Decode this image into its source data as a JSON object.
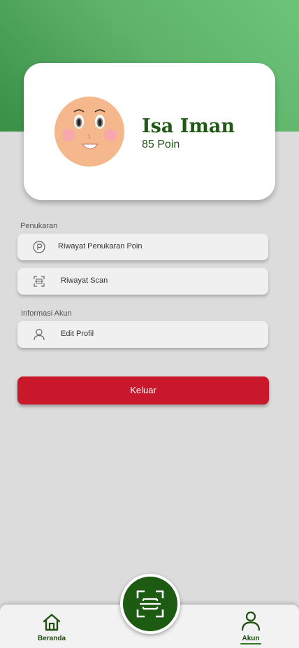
{
  "profile": {
    "name": "Isa Iman",
    "points": "85 Poin",
    "avatar_icon": "cartoon-face-avatar"
  },
  "sections": {
    "exchange_label": "Penukaran",
    "account_label": "Informasi Akun"
  },
  "menu": {
    "exchange_history": {
      "label": "Riwayat Penukaran Poin",
      "icon": "points-p-icon"
    },
    "scan_history": {
      "label": "Riwayat Scan",
      "icon": "scan-frame-icon"
    },
    "edit_profile": {
      "label": "Edit Profil",
      "icon": "user-outline-icon"
    }
  },
  "logout": {
    "label": "Keluar"
  },
  "bottom_nav": {
    "home_label": "Beranda",
    "account_label": "Akun",
    "scan_icon": "scan-frame-icon"
  },
  "colors": {
    "header_gradient_start": "#3a8f46",
    "header_gradient_end": "#6cc479",
    "brand_dark_green": "#1f5a14",
    "logout_red": "#c9182c",
    "background": "#dcdcdc"
  }
}
